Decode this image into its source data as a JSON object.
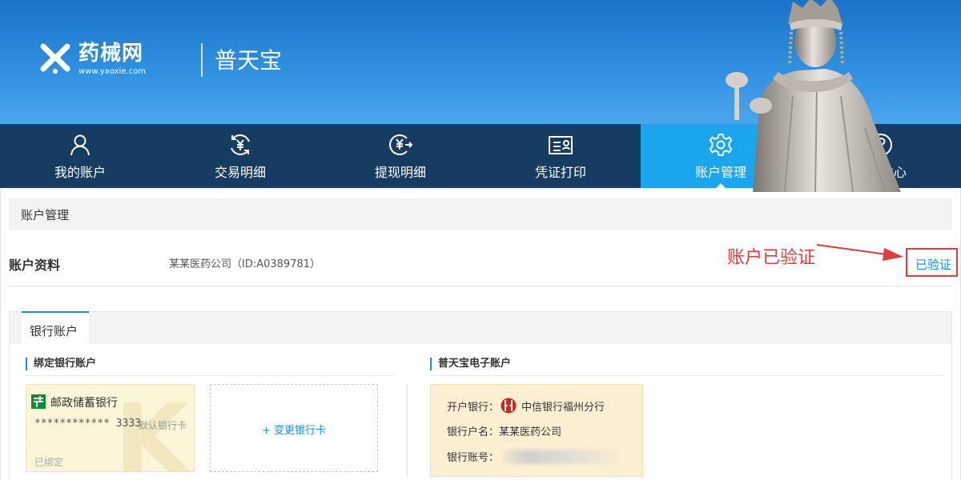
{
  "header": {
    "logo_cn": "药械网",
    "logo_url": "www.yaoxie.com",
    "site_title": "普天宝"
  },
  "nav": {
    "items": [
      {
        "label": "我的账户",
        "icon": "user-icon"
      },
      {
        "label": "交易明细",
        "icon": "yen-cycle-icon"
      },
      {
        "label": "提现明细",
        "icon": "yen-withdraw-icon"
      },
      {
        "label": "凭证打印",
        "icon": "id-card-icon"
      },
      {
        "label": "账户管理",
        "icon": "gear-icon",
        "active": true
      },
      {
        "label": "帮助中心",
        "icon": "help-icon"
      }
    ],
    "active_color": "#1aa6ec",
    "bg_color": "#173c61"
  },
  "account_mgmt": {
    "section_title": "账户管理",
    "profile_label": "账户资料",
    "profile_value": "某某医药公司（ID:A0389781）",
    "verified_link": "已验证",
    "annotation": "账户已验证"
  },
  "bank": {
    "tab_label": "银行账户",
    "bound_title": "绑定银行账户",
    "card": {
      "bank_name": "邮政储蓄银行",
      "number": "************ 3333",
      "default_tag": "默认银行卡",
      "status": "已绑定"
    },
    "change_card": "+ 变更银行卡",
    "e_title": "普天宝电子账户",
    "e_account": {
      "bank_label": "开户银行：",
      "bank_value": "中信银行福州分行",
      "name_label": "银行户名：",
      "name_value": "某某医药公司",
      "number_label": "银行账号："
    }
  }
}
